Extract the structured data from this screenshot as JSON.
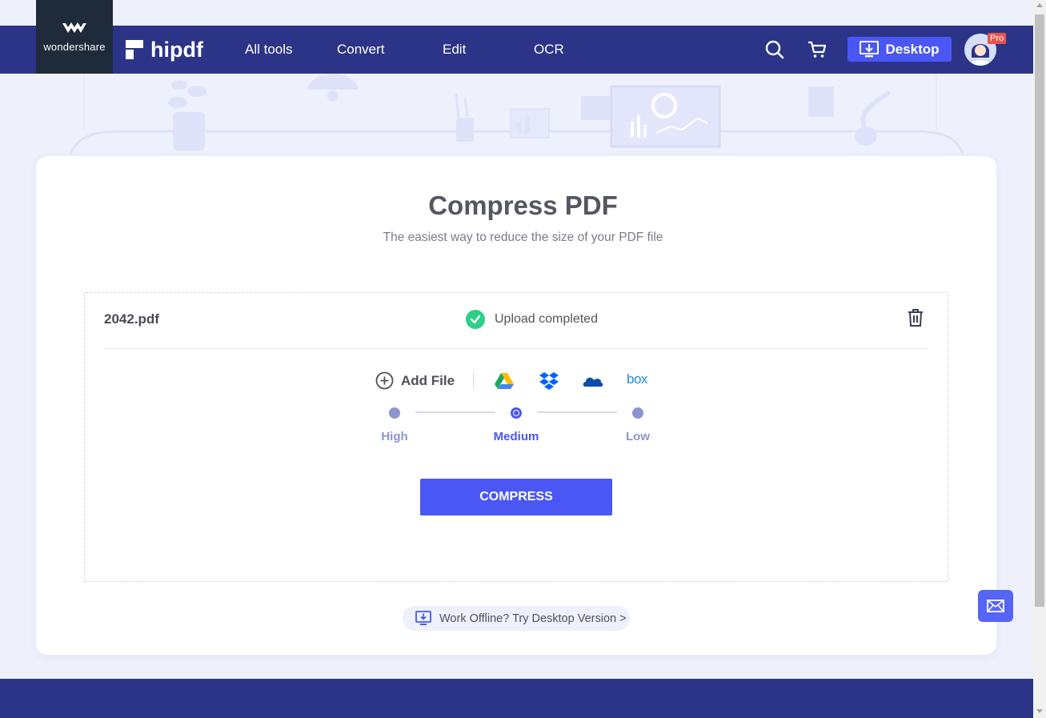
{
  "header": {
    "brand": "wondershare",
    "product": "hipdf",
    "nav": [
      {
        "label": "All tools"
      },
      {
        "label": "Convert"
      },
      {
        "label": "Edit"
      },
      {
        "label": "OCR"
      }
    ],
    "desktop_label": "Desktop",
    "pro_badge": "Pro",
    "icons": [
      "search-icon",
      "cart-icon",
      "download-icon",
      "avatar"
    ]
  },
  "main": {
    "title": "Compress PDF",
    "subtitle": "The easiest way to reduce the size of your PDF file",
    "file": {
      "name": "2042.pdf",
      "status": "Upload completed"
    },
    "add_file_label": "Add File",
    "cloud_sources": [
      "google-drive-icon",
      "dropbox-icon",
      "onedrive-icon",
      "box-icon"
    ],
    "box_label": "box",
    "compression_levels": [
      {
        "label": "High",
        "selected": false
      },
      {
        "label": "Medium",
        "selected": true
      },
      {
        "label": "Low",
        "selected": false
      }
    ],
    "compress_label": "COMPRESS",
    "offline_link": "Work Offline? Try Desktop Version >"
  },
  "colors": {
    "header_bg": "#2c3487",
    "accent": "#4a57f5",
    "success": "#2ecf8a",
    "page_bg": "#eef1fb"
  }
}
